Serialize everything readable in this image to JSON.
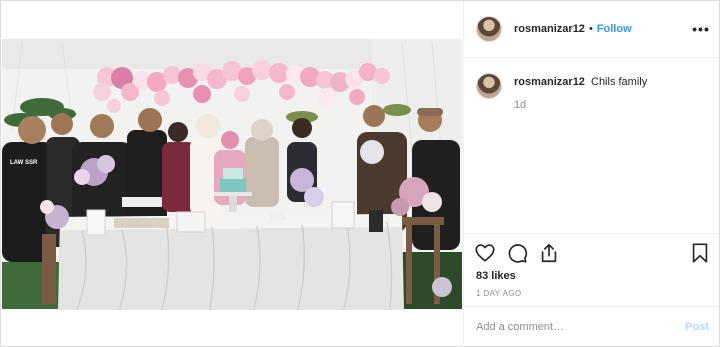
{
  "post": {
    "username": "rosmanizar12",
    "separator": "•",
    "follow_label": "Follow",
    "more_label": "•••",
    "caption_username": "rosmanizar12",
    "caption_text": "Chils family",
    "caption_age": "1d",
    "likes": "83 likes",
    "date": "1 DAY AGO",
    "comment_placeholder": "Add a comment…",
    "post_label": "Post",
    "banner_text": "LAW SSR"
  },
  "icons": {
    "avatar": "avatar-image",
    "more": "more-options-icon",
    "like": "heart-icon",
    "comment": "comment-bubble-icon",
    "share": "share-icon",
    "save": "bookmark-icon"
  },
  "colors": {
    "accent": "#3897f0",
    "post_disabled": "#b3dbff",
    "muted": "#8e8e8e",
    "border": "#dbdbdb"
  }
}
